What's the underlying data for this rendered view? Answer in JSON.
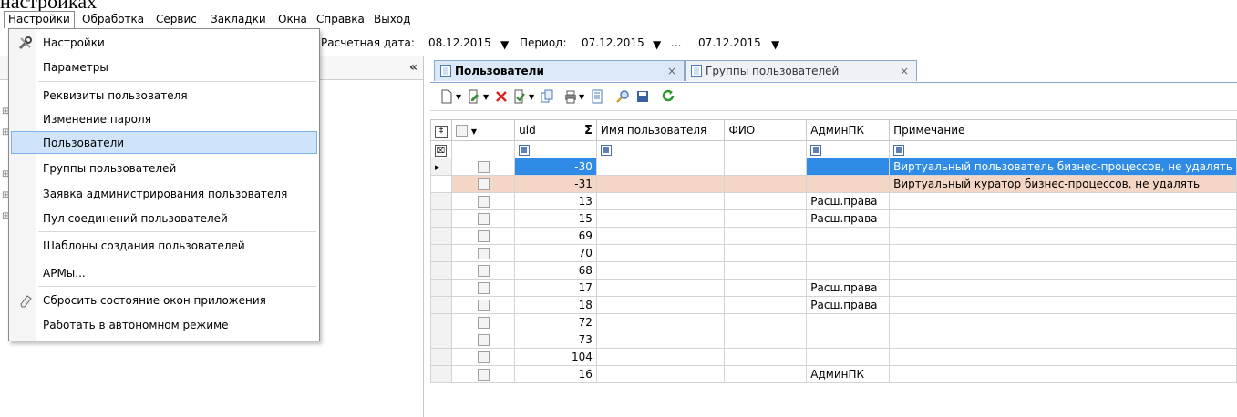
{
  "top_fragment": "настройках",
  "menubar": {
    "items": [
      "Настройки",
      "Обработка",
      "Сервис",
      "Закладки",
      "Окна",
      "Справка",
      "Выход"
    ]
  },
  "dates": {
    "calc_label": "Расчетная дата:",
    "calc_value": "08.12.2015",
    "period_label": "Период:",
    "period_from": "07.12.2015",
    "period_sep": "...",
    "period_to": "07.12.2015"
  },
  "collapse_label": "«",
  "tabs": [
    {
      "label": "Пользователи",
      "active": true,
      "close": "×"
    },
    {
      "label": "Группы пользователей",
      "active": false,
      "close": "×"
    }
  ],
  "dropdown_menu": {
    "items": [
      {
        "label": "Настройки",
        "icon": "tools-icon"
      },
      {
        "label": "Параметры"
      },
      {
        "label": "Реквизиты пользователя"
      },
      {
        "label": "Изменение пароля"
      },
      {
        "label": "Пользователи",
        "selected": true
      },
      {
        "label": "Группы пользователей"
      },
      {
        "label": "Заявка администрирования пользователя"
      },
      {
        "label": "Пул соединений пользователей"
      },
      {
        "label": "Шаблоны создания пользователей"
      },
      {
        "label": "АРМы..."
      },
      {
        "label": "Сбросить состояние окон приложения",
        "icon": "eraser-icon"
      },
      {
        "label": "Работать в автономном режиме"
      }
    ]
  },
  "grid": {
    "columns": [
      "uid",
      "Σ",
      "Имя пользователя",
      "ФИО",
      "АдминПК",
      "Примечание"
    ],
    "rows": [
      {
        "uid": "-30",
        "admin": "",
        "note": "Виртуальный пользователь бизнес-процессов, не удалять",
        "state": "selected"
      },
      {
        "uid": "-31",
        "admin": "",
        "note": "Виртуальный куратор бизнес-процессов, не удалять",
        "state": "highlight"
      },
      {
        "uid": "13",
        "admin": "Расш.права",
        "note": ""
      },
      {
        "uid": "15",
        "admin": "Расш.права",
        "note": ""
      },
      {
        "uid": "69",
        "admin": "",
        "note": ""
      },
      {
        "uid": "70",
        "admin": "",
        "note": ""
      },
      {
        "uid": "68",
        "admin": "",
        "note": ""
      },
      {
        "uid": "17",
        "admin": "Расш.права",
        "note": ""
      },
      {
        "uid": "18",
        "admin": "Расш.права",
        "note": ""
      },
      {
        "uid": "72",
        "admin": "",
        "note": ""
      },
      {
        "uid": "73",
        "admin": "",
        "note": ""
      },
      {
        "uid": "104",
        "admin": "",
        "note": ""
      },
      {
        "uid": "16",
        "admin": "АдминПК",
        "note": ""
      }
    ]
  },
  "colors": {
    "selection": "#2f8be6",
    "highlight_row": "#f4d6c6",
    "menu_hover": "#cfe4fa",
    "tab_active": "#dbe8f7"
  }
}
